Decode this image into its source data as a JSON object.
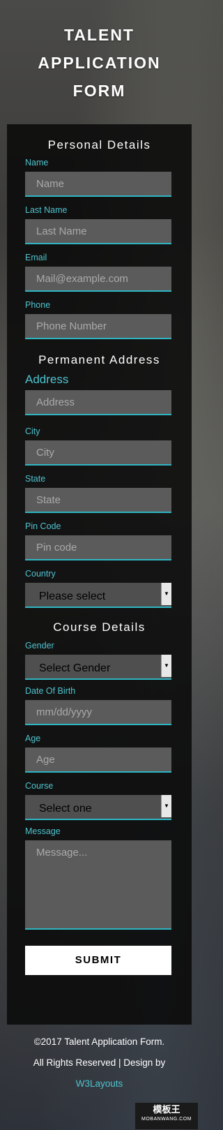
{
  "header": {
    "title_line1": "TALENT",
    "title_line2": "APPLICATION",
    "title_line3": "FORM"
  },
  "personal": {
    "heading": "Personal Details",
    "name_label": "Name",
    "name_placeholder": "Name",
    "last_label": "Last Name",
    "last_placeholder": "Last Name",
    "email_label": "Email",
    "email_placeholder": "Mail@example.com",
    "phone_label": "Phone",
    "phone_placeholder": "Phone Number"
  },
  "address": {
    "heading": "Permanent Address",
    "address_label": "Address",
    "address_placeholder": "Address",
    "city_label": "City",
    "city_placeholder": "City",
    "state_label": "State",
    "state_placeholder": "State",
    "pin_label": "Pin Code",
    "pin_placeholder": "Pin code",
    "country_label": "Country",
    "country_value": "Please select"
  },
  "course": {
    "heading": "Course Details",
    "gender_label": "Gender",
    "gender_value": "Select Gender",
    "dob_label": "Date Of Birth",
    "dob_placeholder": "mm/dd/yyyy",
    "age_label": "Age",
    "age_placeholder": "Age",
    "course_label": "Course",
    "course_value": "Select one",
    "message_label": "Message",
    "message_placeholder": "Message..."
  },
  "submit_label": "SUBMIT",
  "footer": {
    "line1": "©2017 Talent Application Form.",
    "line2": "All Rights Reserved | Design by",
    "link": "W3Layouts"
  },
  "watermark": {
    "text": "模板王",
    "sub": "MOBANWANG.COM"
  },
  "colors": {
    "accent": "#4fc3cf",
    "field_bg": "#5b5b5b",
    "panel_bg": "#0a0a0a"
  }
}
